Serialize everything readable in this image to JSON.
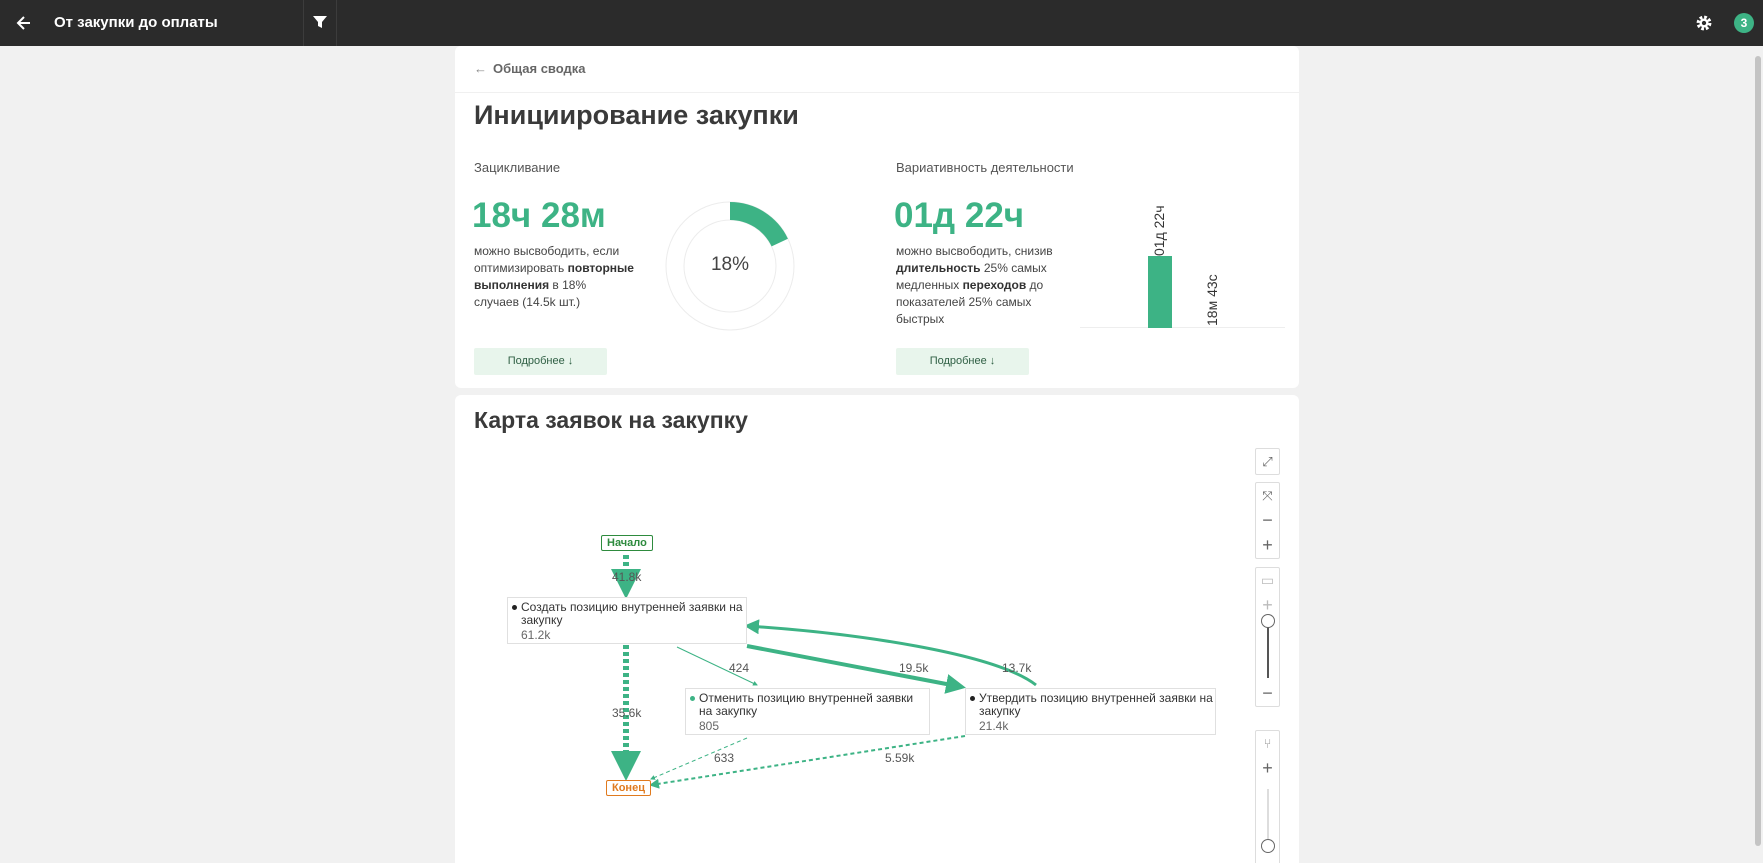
{
  "topbar": {
    "title": "От закупки до оплаты",
    "badge": "3",
    "icons": [
      "back-arrow-icon",
      "filter-icon",
      "gear-icon"
    ]
  },
  "summary": {
    "breadcrumb": "Общая сводка",
    "title": "Инициирование закупки",
    "looping": {
      "label": "Зацикливание",
      "value": "18ч 28м",
      "desc_1": "можно высвободить, если оптимизировать",
      "desc_bold": "повторные выполнения",
      "desc_2": "в 18% случаев (14.5k шт.)",
      "donut_label": "18%",
      "donut_fraction": 0.18,
      "more": "Подробнее ↓"
    },
    "variability": {
      "label": "Вариативность деятельности",
      "value": "01д 22ч",
      "desc_1": "можно высвободить, снизив",
      "desc_bold1": "длительность",
      "desc_2": "25% самых медленных",
      "desc_bold2": "переходов",
      "desc_3": "до показателей 25% самых быстрых",
      "bar1_label": "01д 22ч",
      "bar2_label": "18м 43с",
      "more": "Подробнее ↓"
    }
  },
  "map": {
    "title": "Карта заявок на закупку",
    "start": "Начало",
    "end": "Конец",
    "nodes": [
      {
        "label": "Создать позицию внутренней заявки на закупку",
        "count": "61.2k"
      },
      {
        "label": "Отменить позицию внутренней заявки на закупку",
        "count": "805"
      },
      {
        "label": "Утвердить позицию внутренней заявки на закупку",
        "count": "21.4k"
      }
    ],
    "edges": {
      "start_create": "41.8k",
      "create_end": "35.6k",
      "create_cancel": "424",
      "create_approve": "19.5k",
      "approve_create": "13.7k",
      "cancel_end": "633",
      "approve_end": "5.59k"
    },
    "colors": {
      "accent": "#3db385",
      "start": "#2e8b3e",
      "end": "#e07a1e"
    }
  }
}
